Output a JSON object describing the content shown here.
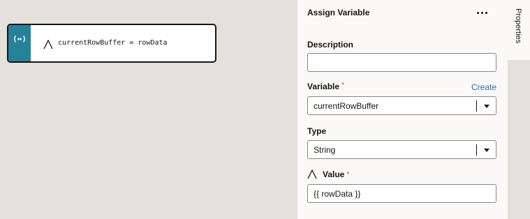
{
  "canvas": {
    "node": {
      "strip_icon": "(↔)",
      "type_icon": "string-type-icon",
      "label": "currentRowBuffer = rowData"
    }
  },
  "panel": {
    "title": "Assign Variable",
    "more_icon": "more-horizontal-icon",
    "description": {
      "label": "Description",
      "value": ""
    },
    "variable": {
      "label": "Variable",
      "required": "*",
      "create_label": "Create",
      "selected": "currentRowBuffer"
    },
    "type": {
      "label": "Type",
      "selected": "String"
    },
    "value": {
      "label": "Value",
      "required": "*",
      "value": "{{ rowData }}",
      "icon": "string-type-icon"
    }
  },
  "side_tab": {
    "label": "Properties"
  },
  "colors": {
    "canvas_bg": "#e4e1dc",
    "panel_bg": "#fbf9f8",
    "node_accent": "#26819a",
    "link": "#2b6ea3"
  }
}
